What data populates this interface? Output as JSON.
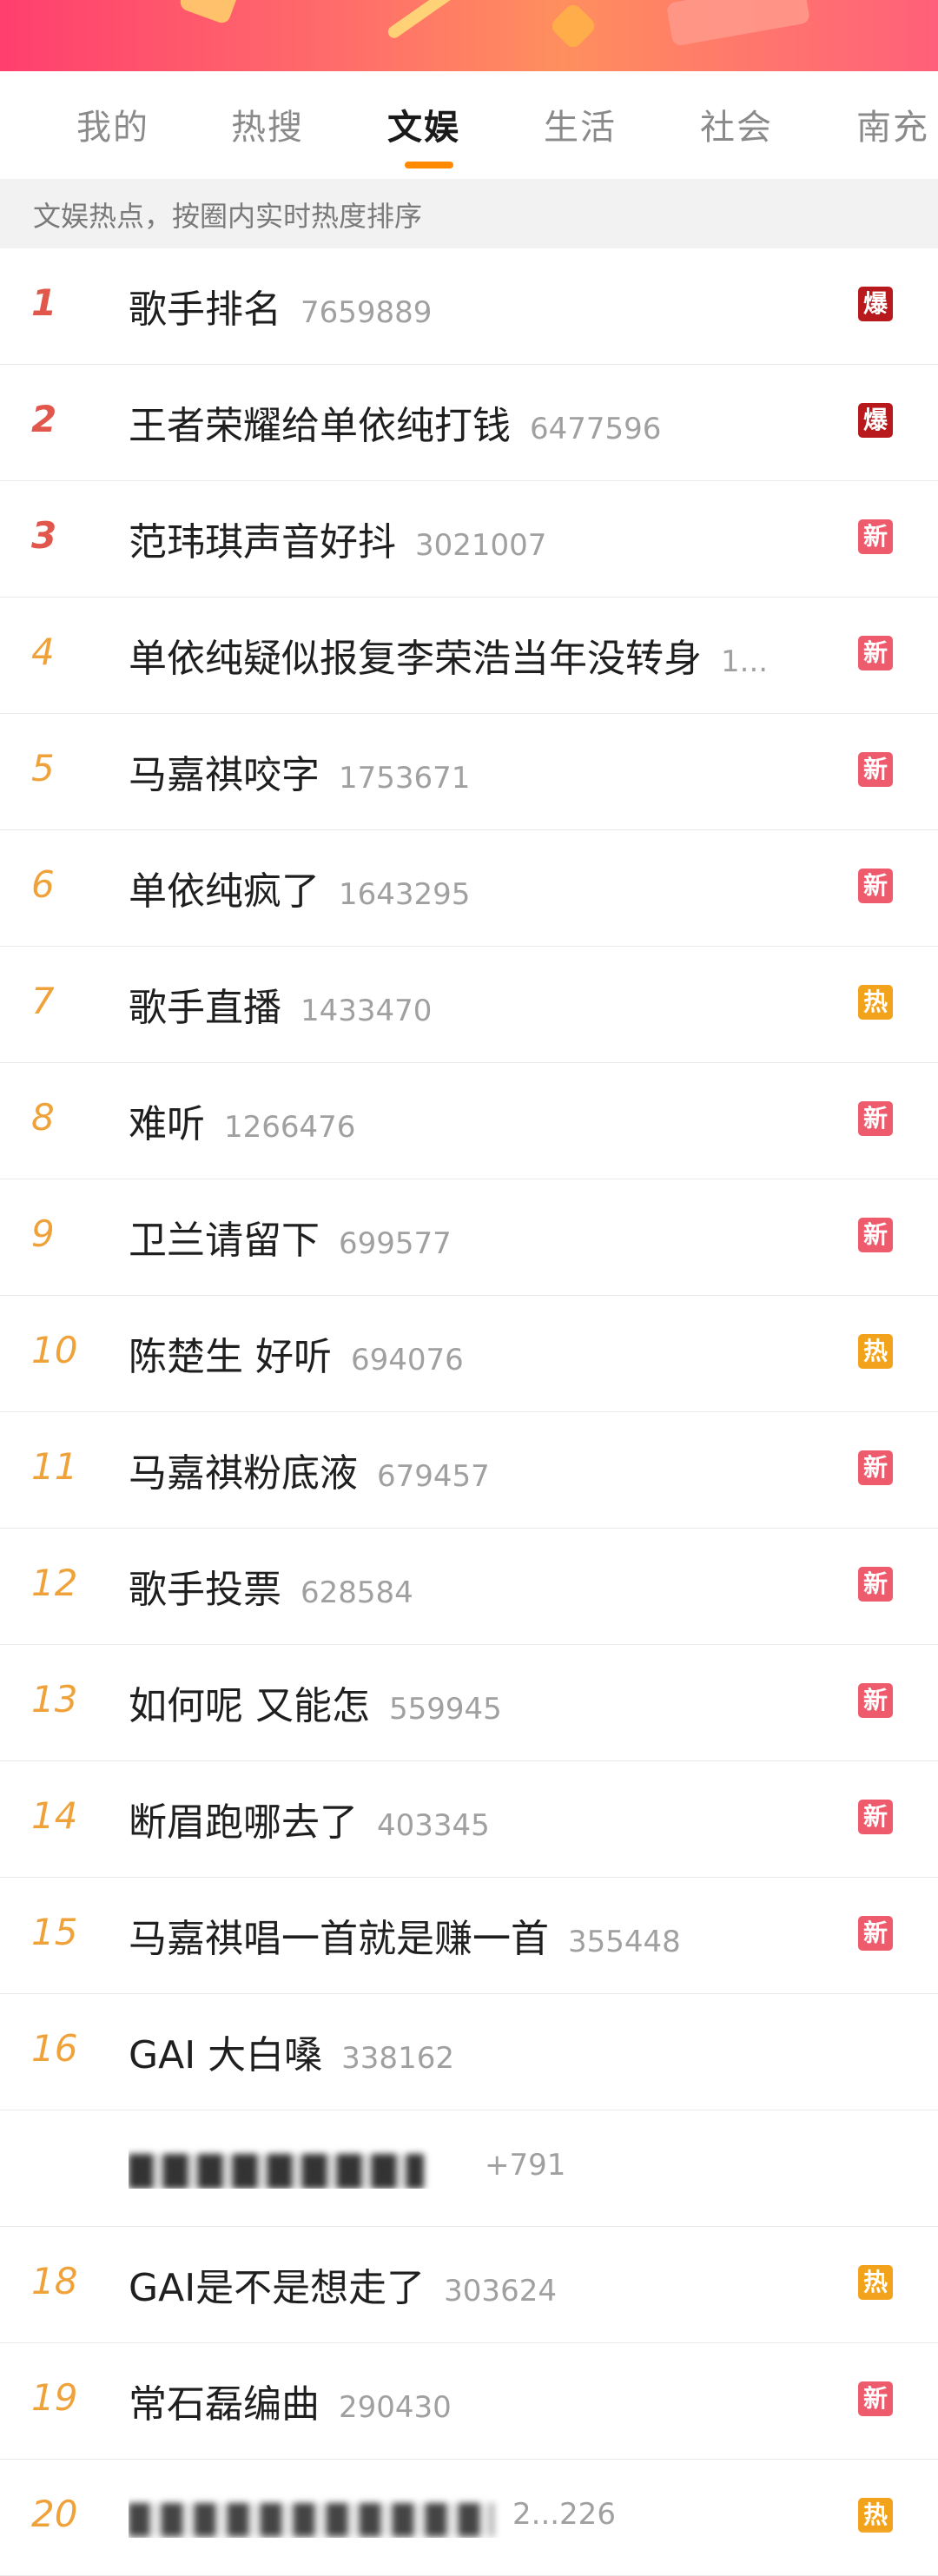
{
  "tabs": [
    {
      "label": "我的"
    },
    {
      "label": "热搜"
    },
    {
      "label": "文娱"
    },
    {
      "label": "生活"
    },
    {
      "label": "社会"
    },
    {
      "label": "南充"
    }
  ],
  "active_tab": "文娱",
  "subtitle": "文娱热点，按圈内实时热度排序",
  "colors": {
    "badge_bao": "#b7191c",
    "badge_xin": "#ee5b6c",
    "badge_re": "#f2a21b",
    "rank_top": "#e2574c",
    "rank_other": "#f0a23a",
    "tab_underline": "#ff8a00"
  },
  "items": [
    {
      "rank": "1",
      "title": "歌手排名",
      "count": "7659889",
      "badge": "爆"
    },
    {
      "rank": "2",
      "title": "王者荣耀给单依纯打钱",
      "count": "6477596",
      "badge": "爆"
    },
    {
      "rank": "3",
      "title": "范玮琪声音好抖",
      "count": "3021007",
      "badge": "新"
    },
    {
      "rank": "4",
      "title": "单依纯疑似报复李荣浩当年没转身",
      "count": "1...",
      "badge": "新"
    },
    {
      "rank": "5",
      "title": "马嘉祺咬字",
      "count": "1753671",
      "badge": "新"
    },
    {
      "rank": "6",
      "title": "单依纯疯了",
      "count": "1643295",
      "badge": "新"
    },
    {
      "rank": "7",
      "title": "歌手直播",
      "count": "1433470",
      "badge": "热"
    },
    {
      "rank": "8",
      "title": "难听",
      "count": "1266476",
      "badge": "新"
    },
    {
      "rank": "9",
      "title": "卫兰请留下",
      "count": "699577",
      "badge": "新"
    },
    {
      "rank": "10",
      "title": "陈楚生 好听",
      "count": "694076",
      "badge": "热"
    },
    {
      "rank": "11",
      "title": "马嘉祺粉底液",
      "count": "679457",
      "badge": "新"
    },
    {
      "rank": "12",
      "title": "歌手投票",
      "count": "628584",
      "badge": "新"
    },
    {
      "rank": "13",
      "title": "如何呢 又能怎",
      "count": "559945",
      "badge": "新"
    },
    {
      "rank": "14",
      "title": "断眉跑哪去了",
      "count": "403345",
      "badge": "新"
    },
    {
      "rank": "15",
      "title": "马嘉祺唱一首就是赚一首",
      "count": "355448",
      "badge": "新"
    },
    {
      "rank": "16",
      "title": "GAI 大白嗓",
      "count": "338162",
      "badge": ""
    },
    {
      "rank": "",
      "title": "",
      "count": "+791",
      "badge": ""
    },
    {
      "rank": "18",
      "title": "GAI是不是想走了",
      "count": "303624",
      "badge": "热"
    },
    {
      "rank": "19",
      "title": "常石磊编曲",
      "count": "290430",
      "badge": "新"
    },
    {
      "rank": "20",
      "title": "",
      "count": "2...226",
      "badge": "热"
    }
  ]
}
